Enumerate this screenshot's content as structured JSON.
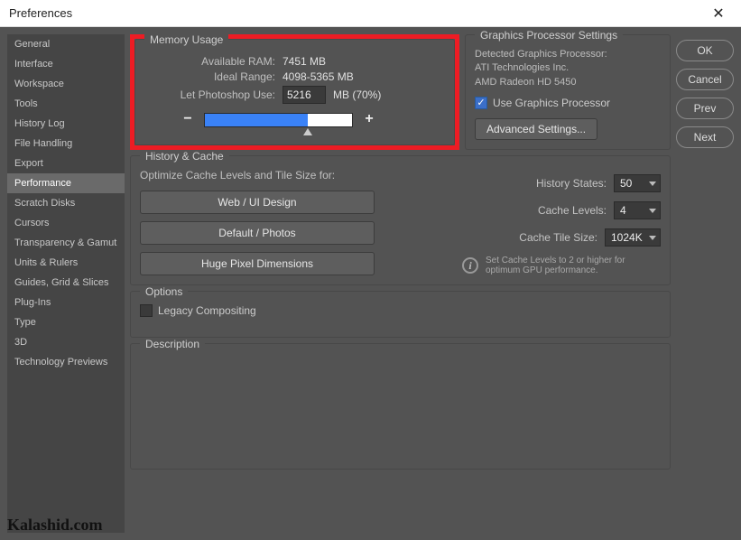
{
  "window": {
    "title": "Preferences"
  },
  "sidebar": {
    "items": [
      {
        "label": "General"
      },
      {
        "label": "Interface"
      },
      {
        "label": "Workspace"
      },
      {
        "label": "Tools"
      },
      {
        "label": "History Log"
      },
      {
        "label": "File Handling"
      },
      {
        "label": "Export"
      },
      {
        "label": "Performance",
        "selected": true
      },
      {
        "label": "Scratch Disks"
      },
      {
        "label": "Cursors"
      },
      {
        "label": "Transparency & Gamut"
      },
      {
        "label": "Units & Rulers"
      },
      {
        "label": "Guides, Grid & Slices"
      },
      {
        "label": "Plug-Ins"
      },
      {
        "label": "Type"
      },
      {
        "label": "3D"
      },
      {
        "label": "Technology Previews"
      }
    ]
  },
  "buttons": {
    "ok": "OK",
    "cancel": "Cancel",
    "prev": "Prev",
    "next": "Next"
  },
  "memory": {
    "legend": "Memory Usage",
    "available_label": "Available RAM:",
    "available_value": "7451 MB",
    "ideal_label": "Ideal Range:",
    "ideal_value": "4098-5365 MB",
    "let_label": "Let Photoshop Use:",
    "let_value": "5216",
    "let_suffix": "MB (70%)",
    "minus": "−",
    "plus": "+"
  },
  "gpu": {
    "legend": "Graphics Processor Settings",
    "detected_label": "Detected Graphics Processor:",
    "vendor": "ATI Technologies Inc.",
    "card": "AMD Radeon HD 5450",
    "use_label": "Use Graphics Processor",
    "advanced_btn": "Advanced Settings..."
  },
  "history": {
    "legend": "History & Cache",
    "optimize_label": "Optimize Cache Levels and Tile Size for:",
    "btn_web": "Web / UI Design",
    "btn_default": "Default / Photos",
    "btn_huge": "Huge Pixel Dimensions",
    "states_label": "History States:",
    "states_value": "50",
    "levels_label": "Cache Levels:",
    "levels_value": "4",
    "tile_label": "Cache Tile Size:",
    "tile_value": "1024K",
    "hint": "Set Cache Levels to 2 or higher for optimum GPU performance."
  },
  "options": {
    "legend": "Options",
    "legacy_label": "Legacy Compositing"
  },
  "description": {
    "legend": "Description"
  },
  "watermark": "Kalashid.com"
}
